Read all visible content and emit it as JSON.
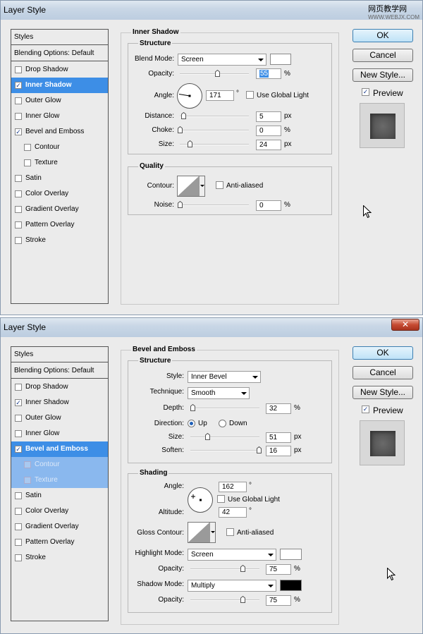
{
  "watermark": {
    "site": "网页教学网",
    "url": "WWW.WEBJX.COM"
  },
  "dialogs": [
    {
      "title": "Layer Style",
      "styles_header": "Styles",
      "blending": "Blending Options: Default",
      "list": [
        {
          "label": "Drop Shadow",
          "checked": false
        },
        {
          "label": "Inner Shadow",
          "checked": true
        },
        {
          "label": "Outer Glow",
          "checked": false
        },
        {
          "label": "Inner Glow",
          "checked": false
        },
        {
          "label": "Bevel and Emboss",
          "checked": true
        },
        {
          "label": "Contour",
          "checked": false
        },
        {
          "label": "Texture",
          "checked": false
        },
        {
          "label": "Satin",
          "checked": false
        },
        {
          "label": "Color Overlay",
          "checked": false
        },
        {
          "label": "Gradient Overlay",
          "checked": false
        },
        {
          "label": "Pattern Overlay",
          "checked": false
        },
        {
          "label": "Stroke",
          "checked": false
        }
      ],
      "section": "Inner Shadow",
      "structure": "Structure",
      "blend_mode_label": "Blend Mode:",
      "blend_mode": "Screen",
      "blend_color": "#ffffff",
      "opacity_label": "Opacity:",
      "opacity": "55",
      "opacity_unit": "%",
      "angle_label": "Angle:",
      "angle": "171",
      "degree": "°",
      "use_global_light": "Use Global Light",
      "distance_label": "Distance:",
      "distance": "5",
      "distance_unit": "px",
      "choke_label": "Choke:",
      "choke": "0",
      "choke_unit": "%",
      "size_label": "Size:",
      "size": "24",
      "size_unit": "px",
      "quality": "Quality",
      "contour_label": "Contour:",
      "anti_aliased": "Anti-aliased",
      "noise_label": "Noise:",
      "noise": "0",
      "noise_unit": "%",
      "ok": "OK",
      "cancel": "Cancel",
      "new_style": "New Style...",
      "preview": "Preview"
    },
    {
      "title": "Layer Style",
      "styles_header": "Styles",
      "blending": "Blending Options: Default",
      "list": [
        {
          "label": "Drop Shadow",
          "checked": false
        },
        {
          "label": "Inner Shadow",
          "checked": true
        },
        {
          "label": "Outer Glow",
          "checked": false
        },
        {
          "label": "Inner Glow",
          "checked": false
        },
        {
          "label": "Bevel and Emboss",
          "checked": true
        },
        {
          "label": "Contour",
          "checked": false
        },
        {
          "label": "Texture",
          "checked": false
        },
        {
          "label": "Satin",
          "checked": false
        },
        {
          "label": "Color Overlay",
          "checked": false
        },
        {
          "label": "Gradient Overlay",
          "checked": false
        },
        {
          "label": "Pattern Overlay",
          "checked": false
        },
        {
          "label": "Stroke",
          "checked": false
        }
      ],
      "section": "Bevel and Emboss",
      "structure": "Structure",
      "style_label": "Style:",
      "style": "Inner Bevel",
      "technique_label": "Technique:",
      "technique": "Smooth",
      "depth_label": "Depth:",
      "depth": "32",
      "depth_unit": "%",
      "direction_label": "Direction:",
      "dir_up": "Up",
      "dir_down": "Down",
      "size_label": "Size:",
      "size": "51",
      "size_unit": "px",
      "soften_label": "Soften:",
      "soften": "16",
      "soften_unit": "px",
      "shading": "Shading",
      "angle_label": "Angle:",
      "angle": "162",
      "degree": "°",
      "use_global_light": "Use Global Light",
      "altitude_label": "Altitude:",
      "altitude": "42",
      "gloss_contour_label": "Gloss Contour:",
      "anti_aliased": "Anti-aliased",
      "highlight_mode_label": "Highlight Mode:",
      "highlight_mode": "Screen",
      "highlight_color": "#ffffff",
      "hl_opacity_label": "Opacity:",
      "hl_opacity": "75",
      "hl_opacity_unit": "%",
      "shadow_mode_label": "Shadow Mode:",
      "shadow_mode": "Multiply",
      "shadow_color": "#000000",
      "sh_opacity_label": "Opacity:",
      "sh_opacity": "75",
      "sh_opacity_unit": "%",
      "ok": "OK",
      "cancel": "Cancel",
      "new_style": "New Style...",
      "preview": "Preview"
    }
  ]
}
